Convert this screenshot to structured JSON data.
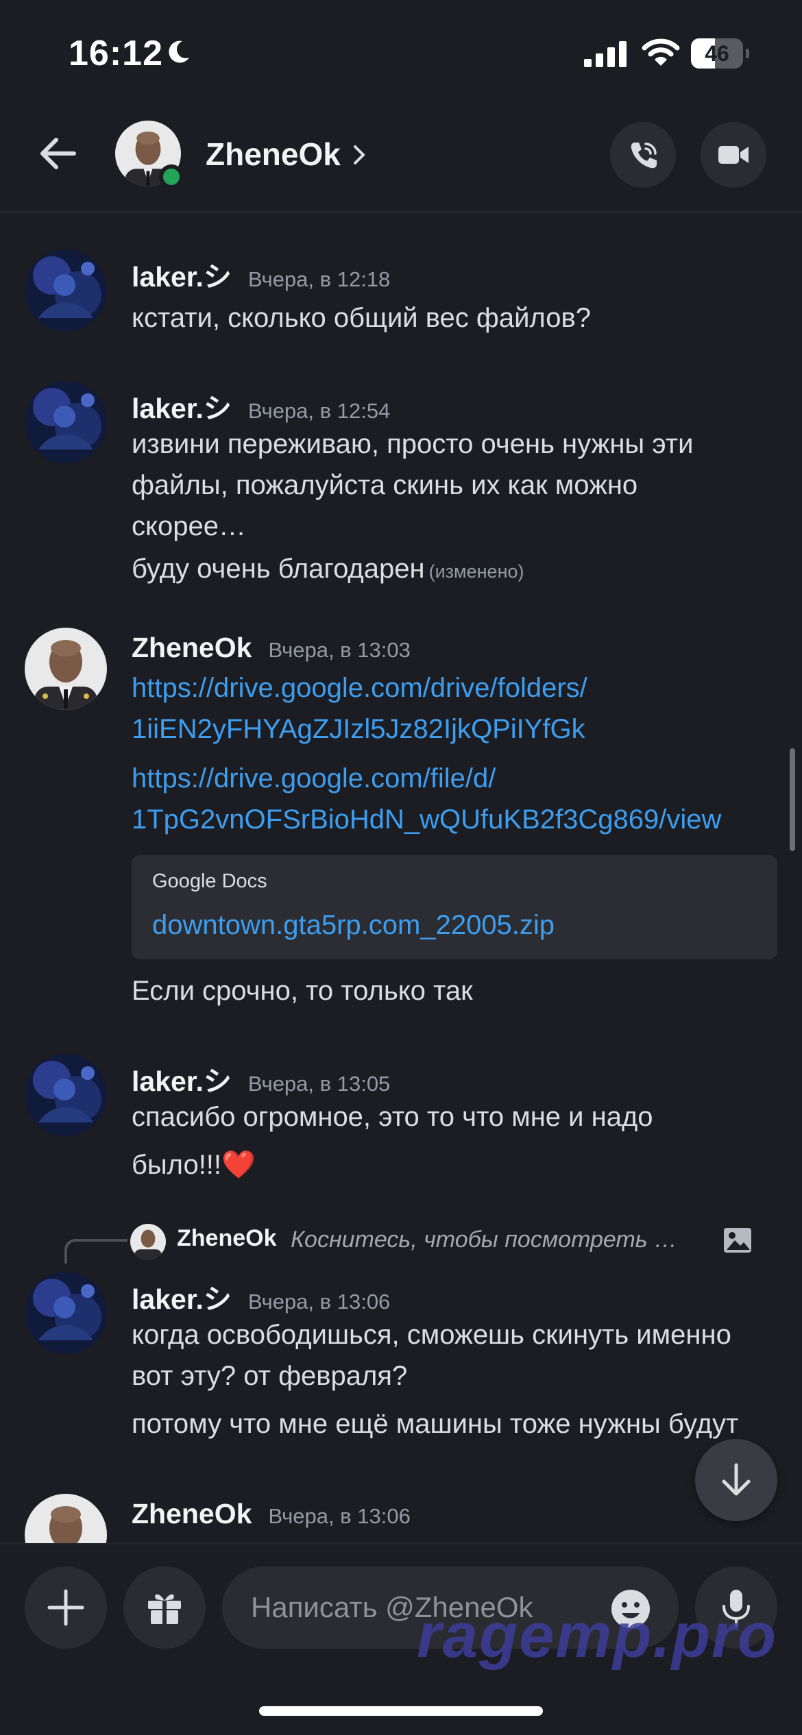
{
  "status_bar": {
    "time": "16:12",
    "battery": "46",
    "battery_level": 0.46
  },
  "header": {
    "contact_name": "ZheneOk"
  },
  "messages": [
    {
      "author": "laker.シ",
      "time": "Вчера, в 12:18",
      "lines": [
        "кстати, сколько общий вес файлов?"
      ]
    },
    {
      "author": "laker.シ",
      "time": "Вчера, в 12:54",
      "lines": [
        "извини переживаю, просто очень нужны эти",
        "файлы, пожалуйста скинь их как можно",
        "скорее…",
        "буду очень благодарен"
      ],
      "edited": "(изменено)"
    },
    {
      "author": "ZheneOk",
      "time": "Вчера, в 13:03",
      "links": [
        "https://drive.google.com/drive/folders/",
        "1iiEN2yFHYAgZJIzl5Jz82IjkQPiIYfGk",
        "https://drive.google.com/file/d/",
        "1TpG2vnOFSrBioHdN_wQUfuKB2f3Cg869/view"
      ],
      "embed": {
        "provider": "Google Docs",
        "title": "downtown.gta5rp.com_22005.zip"
      },
      "after": "Если срочно, то только так"
    },
    {
      "author": "laker.シ",
      "time": "Вчера, в 13:05",
      "lines": [
        "спасибо огромное, это то что мне и надо",
        "было!!!"
      ],
      "emoji": "❤️"
    },
    {
      "reply": {
        "author": "ZheneOk",
        "preview": "Коснитесь, чтобы посмотреть …"
      },
      "author": "laker.シ",
      "time": "Вчера, в 13:06",
      "lines": [
        "когда освободишься, сможешь скинуть именно",
        "вот эту? от февраля?",
        "потому что мне ещё машины тоже нужны будут"
      ]
    },
    {
      "author": "ZheneOk",
      "time": "Вчера, в 13:06"
    }
  ],
  "composer": {
    "placeholder": "Написать @ZheneOk"
  },
  "watermark": "ragemp.pro",
  "icons": [
    "back-arrow-icon",
    "call-icon",
    "video-icon",
    "plus-icon",
    "gift-icon",
    "emoji-icon",
    "mic-icon",
    "arrow-down-icon",
    "image-icon",
    "moon-icon",
    "signal-icon",
    "wifi-icon"
  ],
  "colors": {
    "background": "#1c1d22",
    "link": "#3d9ef0",
    "online": "#23a559",
    "muted": "#949ba4"
  }
}
